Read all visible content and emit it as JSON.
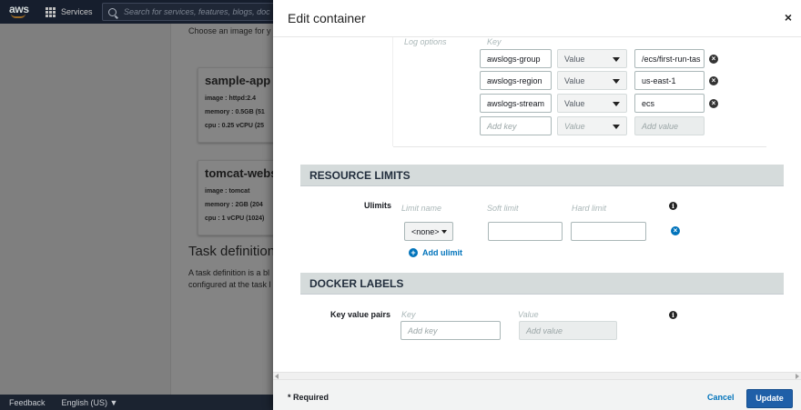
{
  "nav": {
    "logo": "aws",
    "services_label": "Services",
    "search_placeholder": "Search for services, features, blogs, doc"
  },
  "background": {
    "choose_text": "Choose an image for y",
    "cards": [
      {
        "title": "sample-app",
        "image": "image : httpd:2.4",
        "memory": "memory :  0.5GB (51",
        "cpu": "cpu :  0.25 vCPU (25"
      },
      {
        "title": "tomcat-websé",
        "image": "image : tomcat",
        "memory": "memory :  2GB (204",
        "cpu": "cpu :  1 vCPU (1024)"
      }
    ],
    "task_def_heading": "Task definition",
    "task_def_line1": "A task definition is a bl",
    "task_def_line2": "configured at the task l"
  },
  "footer": {
    "feedback": "Feedback",
    "language": "English (US) ▼"
  },
  "modal": {
    "title": "Edit container",
    "close_glyph": "×",
    "log_options": {
      "label": "Log options",
      "key_header": "Key",
      "rows": [
        {
          "key": "awslogs-group",
          "type": "Value",
          "value": "/ecs/first-run-tas"
        },
        {
          "key": "awslogs-region",
          "type": "Value",
          "value": "us-east-1"
        },
        {
          "key": "awslogs-stream",
          "type": "Value",
          "value": "ecs"
        }
      ],
      "new_row": {
        "key_placeholder": "Add key",
        "type": "Value",
        "value_placeholder": "Add value"
      }
    },
    "resource_limits": {
      "header": "RESOURCE LIMITS",
      "ulimits_label": "Ulimits",
      "limit_name_header": "Limit name",
      "soft_limit_header": "Soft limit",
      "hard_limit_header": "Hard limit",
      "limit_name_value": "<none>",
      "add_ulimit": "Add ulimit"
    },
    "docker_labels": {
      "header": "DOCKER LABELS",
      "kv_label": "Key value pairs",
      "key_header": "Key",
      "value_header": "Value",
      "key_placeholder": "Add key",
      "value_placeholder": "Add value"
    },
    "footer": {
      "required": "* Required",
      "cancel": "Cancel",
      "update": "Update"
    }
  }
}
